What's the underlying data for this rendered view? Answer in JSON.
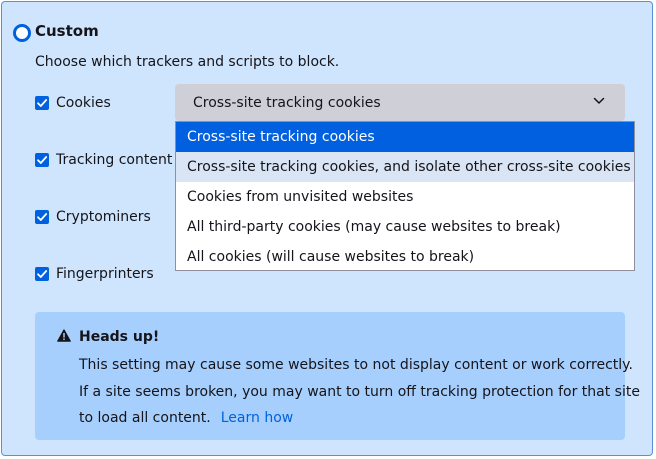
{
  "custom_option": {
    "title": "Custom",
    "description": "Choose which trackers and scripts to block."
  },
  "checkboxes": [
    {
      "label": "Cookies",
      "checked": true
    },
    {
      "label": "Tracking content",
      "checked": true
    },
    {
      "label": "Cryptominers",
      "checked": true
    },
    {
      "label": "Fingerprinters",
      "checked": true
    }
  ],
  "cookie_select": {
    "value": "Cross-site tracking cookies",
    "options": [
      "Cross-site tracking cookies",
      "Cross-site tracking cookies, and isolate other cross-site cookies",
      "Cookies from unvisited websites",
      "All third-party cookies (may cause websites to break)",
      "All cookies (will cause websites to break)"
    ],
    "selected_option": "Cross-site tracking cookies",
    "hovered_option": "Cross-site tracking cookies, and isolate other cross-site cookies"
  },
  "warning": {
    "icon": "warning-triangle-icon",
    "title": "Heads up!",
    "lines": [
      "This setting may cause some websites to not display content or work correctly.",
      "If a site seems broken, you may want to turn off tracking protection for that site",
      "to load all content."
    ],
    "link_text": "Learn how"
  },
  "colors": {
    "panel_background": "#cfe5fd",
    "accent": "#0061e0",
    "selected_option": "#0060df",
    "warning_background": "#a7cffd"
  }
}
